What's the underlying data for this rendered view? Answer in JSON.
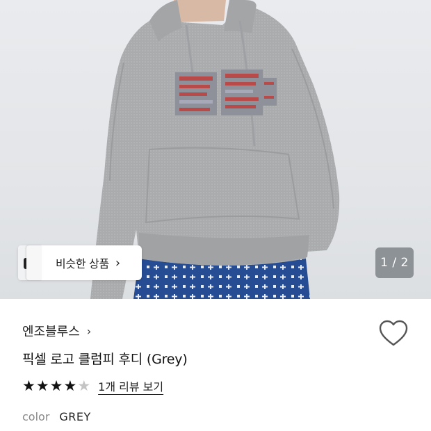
{
  "gallery": {
    "similar_button_label": "비슷한 상품",
    "similar_button_chevron": "›",
    "counter": "1 / 2",
    "current_image": 1,
    "total_images": 2
  },
  "product": {
    "brand": "엔조블루스",
    "brand_chevron": "›",
    "title": "픽셀 로고 클럼피 후디 (Grey)",
    "rating_value": 4,
    "rating_max": 5,
    "review_link": "1개 리뷰 보기",
    "color_label": "color",
    "color_value": "GREY"
  },
  "icons": {
    "wishlist": "heart-outline-icon",
    "stars": "star-icon"
  },
  "colors": {
    "hoodie_grey": "#a9abad",
    "skirt_blue": "#2a4f95",
    "star_filled": "#111111",
    "star_empty": "#c4c4c4"
  }
}
